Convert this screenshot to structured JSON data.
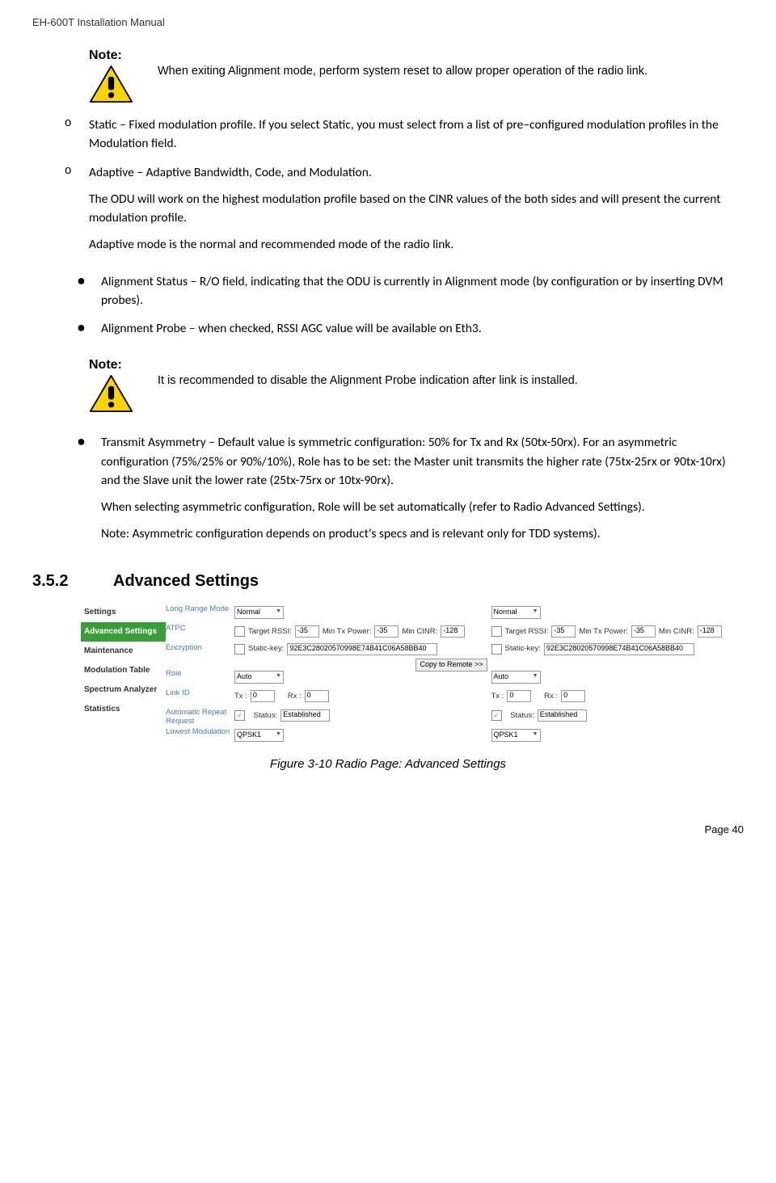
{
  "header": "EH-600T Installation Manual",
  "note1": {
    "label": "Note:",
    "text": "When exiting Alignment mode, perform system reset to allow proper operation of the radio link."
  },
  "subitems": [
    {
      "marker": "o",
      "text": "Static – Fixed modulation profile. If you select Static, you must select from a list of pre–configured modulation profiles in the Modulation field."
    },
    {
      "marker": "o",
      "paras": [
        "Adaptive – Adaptive Bandwidth, Code, and Modulation.",
        "The ODU will work on the highest modulation profile based on the CINR values of the both sides and will present the current modulation profile.",
        "Adaptive mode is the normal and recommended mode of the radio link."
      ]
    }
  ],
  "bullets1": [
    {
      "marker": "●",
      "text": "Alignment Status – R/O field, indicating that the ODU is currently in Alignment mode (by configuration or by inserting DVM probes)."
    },
    {
      "marker": "●",
      "text": "Alignment Probe – when checked, RSSI AGC value will be available on Eth3."
    }
  ],
  "note2": {
    "label": "Note:",
    "text": "It is recommended to disable the Alignment Probe indication after link is installed."
  },
  "bullets2": [
    {
      "marker": "●",
      "paras": [
        "Transmit Asymmetry – Default value is symmetric configuration: 50% for Tx and Rx (50tx-50rx). For an asymmetric configuration (75%/25% or 90%/10%), Role has to be set: the Master unit transmits the higher rate (75tx-25rx or 90tx-10rx) and the Slave unit the lower rate (25tx-75rx or 10tx-90rx).",
        "When selecting asymmetric configuration, Role will be set automatically (refer to Radio Advanced Settings).",
        "Note: Asymmetric configuration depends on product's specs and is relevant only for TDD systems)."
      ]
    }
  ],
  "section": {
    "num": "3.5.2",
    "title": "Advanced Settings"
  },
  "figure": {
    "sidebar": [
      "Settings",
      "Advanced Settings",
      "Maintenance",
      "Modulation Table",
      "Spectrum Analyzer",
      "Statistics"
    ],
    "labels": [
      "Long Range Mode",
      "ATPC",
      "Encryption",
      "Role",
      "Link ID",
      "Automatic Repeat Request",
      "Lowest Modulation"
    ],
    "col": {
      "longrange": "Normal",
      "atpc_trssi_l": "Target RSSI:",
      "atpc_trssi_v": "-35",
      "atpc_mtx_l": "Min Tx Power:",
      "atpc_mtx_v": "-35",
      "atpc_mc_l": "Min CINR:",
      "atpc_mc_v": "-128",
      "enc_l": "Static-key:",
      "enc_v": "92E3C28020570998E74B41C06A58BB40",
      "copy_btn": "Copy to Remote >>",
      "role": "Auto",
      "link_tx_l": "Tx :",
      "link_tx_v": "0",
      "link_rx_l": "Rx :",
      "link_rx_v": "0",
      "arq_l": "Status:",
      "arq_v": "Established",
      "lowmod": "QPSK1"
    },
    "caption": "Figure 3-10 Radio Page: Advanced Settings"
  },
  "footer": "Page 40"
}
